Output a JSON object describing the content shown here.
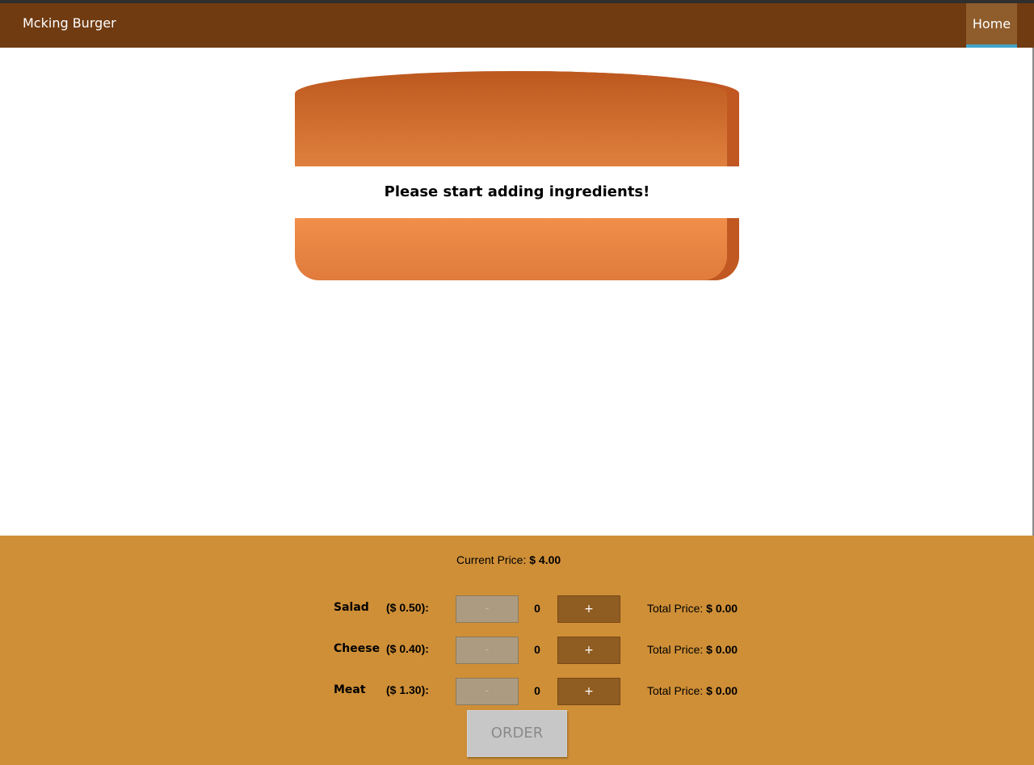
{
  "toolbar": {
    "brand": "Mcking Burger",
    "nav": {
      "home_label": "Home"
    }
  },
  "burger": {
    "message": "Please start adding ingredients!"
  },
  "controls": {
    "current_price_label": "Current Price:",
    "current_price_value": "$ 4.00",
    "ingredients": [
      {
        "name": "Salad",
        "price": "($ 0.50):",
        "less_label": "-",
        "quantity": "0",
        "more_label": "+",
        "total_label": "Total Price:",
        "total_value": "$ 0.00"
      },
      {
        "name": "Cheese",
        "price": "($ 0.40):",
        "less_label": "-",
        "quantity": "0",
        "more_label": "+",
        "total_label": "Total Price:",
        "total_value": "$ 0.00"
      },
      {
        "name": "Meat",
        "price": "($ 1.30):",
        "less_label": "-",
        "quantity": "0",
        "more_label": "+",
        "total_label": "Total Price:",
        "total_value": "$ 0.00"
      }
    ],
    "order_label": "ORDER"
  },
  "colors": {
    "toolbar": "#703b11",
    "nav_active": "#8f5c2c",
    "nav_underline": "#40a4c8",
    "controls_background": "#cf8f37",
    "more_button": "#8f5c22",
    "less_button_disabled": "#ac9b80",
    "order_button_disabled": "#c7c7c7",
    "bread": "#e0803e"
  }
}
